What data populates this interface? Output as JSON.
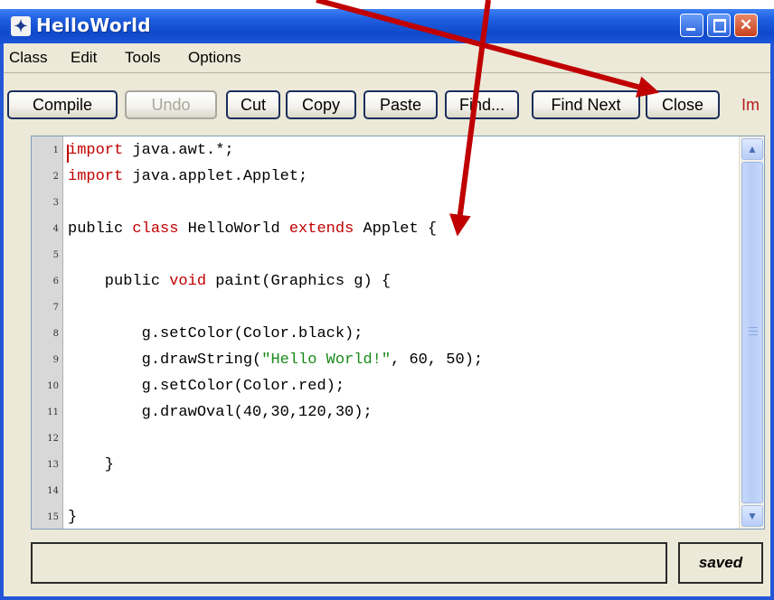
{
  "window": {
    "title": "HelloWorld",
    "close_glyph": "✕"
  },
  "menu": [
    "Class",
    "Edit",
    "Tools",
    "Options"
  ],
  "toolbar": {
    "compile": "Compile",
    "undo": "Undo",
    "cut": "Cut",
    "copy": "Copy",
    "paste": "Paste",
    "find": "Find...",
    "find_next": "Find Next",
    "close": "Close",
    "truncated": "Im"
  },
  "editor": {
    "line_numbers": [
      "1",
      "2",
      "3",
      "4",
      "5",
      "6",
      "7",
      "8",
      "9",
      "10",
      "11",
      "12",
      "13",
      "14",
      "15"
    ],
    "lines": [
      "import java.awt.*;",
      "import java.applet.Applet;",
      "",
      "public class HelloWorld extends Applet {",
      "",
      "    public void paint(Graphics g) {",
      "",
      "        g.setColor(Color.black);",
      "        g.drawString(\"Hello World!\", 60, 50);",
      "        g.setColor(Color.red);",
      "        g.drawOval(40,30,120,30);",
      "",
      "    }",
      "",
      "}"
    ]
  },
  "status": {
    "message": "",
    "saved": "saved"
  },
  "annotation_color": "#c00000"
}
